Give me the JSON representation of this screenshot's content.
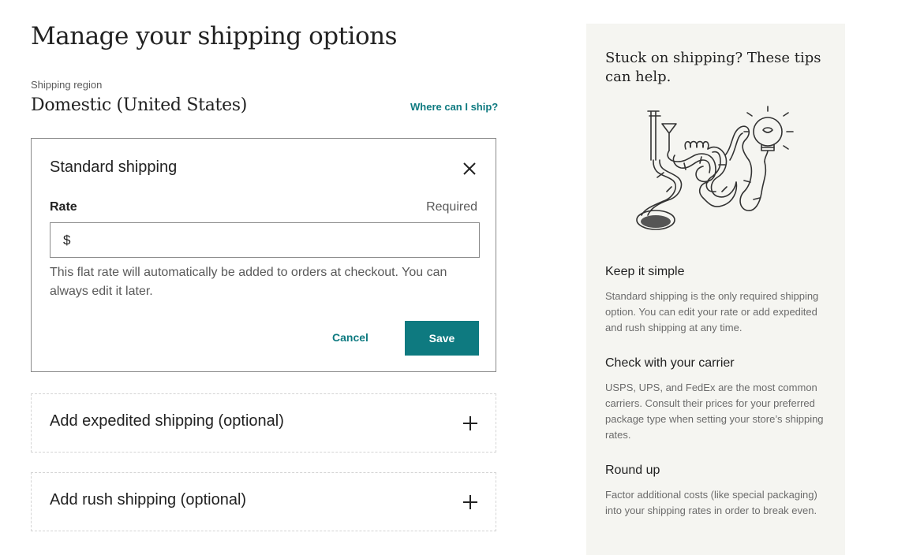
{
  "page": {
    "title": "Manage your shipping options"
  },
  "region": {
    "label": "Shipping region",
    "value": "Domestic (United States)",
    "link": "Where can I ship?"
  },
  "standard": {
    "title": "Standard shipping",
    "close_icon": "close-icon",
    "rate_label": "Rate",
    "required": "Required",
    "currency": "$",
    "rate_value": "",
    "help": "This flat rate will automatically be added to orders at checkout. You can always edit it later.",
    "cancel": "Cancel",
    "save": "Save"
  },
  "options": [
    {
      "label": "Add expedited shipping (optional)",
      "icon": "plus-icon"
    },
    {
      "label": "Add rush shipping (optional)",
      "icon": "plus-icon"
    }
  ],
  "tips": {
    "title": "Stuck on shipping? These tips can help.",
    "illustration": "shipping-tips-illustration",
    "items": [
      {
        "heading": "Keep it simple",
        "body": "Standard shipping is the only required shipping option. You can edit your rate or add expedited and rush shipping at any time."
      },
      {
        "heading": "Check with your carrier",
        "body": "USPS, UPS, and FedEx are the most common carriers. Consult their prices for your preferred package type when setting your store’s shipping rates."
      },
      {
        "heading": "Round up",
        "body": "Factor additional costs (like special packaging) into your shipping rates in order to break even."
      }
    ]
  },
  "colors": {
    "accent": "#0e7a80",
    "tips_bg": "#f5f5f1",
    "border": "#8a8a8a"
  }
}
